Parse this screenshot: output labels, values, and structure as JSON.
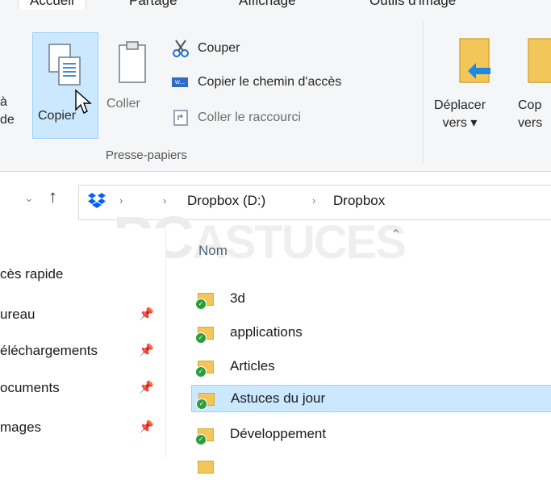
{
  "ribbon_tabs": [
    "Accueil",
    "Partage",
    "Affichage",
    "Outils d'image"
  ],
  "clipboard": {
    "pin_partial_line1": "à",
    "pin_partial_line2": "de",
    "copy_label": "Copier",
    "paste_label": "Coller",
    "cut_label": "Couper",
    "copy_path_label": "Copier le chemin d'accès",
    "paste_shortcut_label": "Coller le raccourci",
    "group_label": "Presse-papiers"
  },
  "organize": {
    "move_to_label1": "Déplacer",
    "move_to_label2": "vers ▾",
    "copy_to_label1": "Cop",
    "copy_to_label2": "vers"
  },
  "address": {
    "crumbs": [
      "Dropbox (D:)",
      "Dropbox"
    ]
  },
  "nav": {
    "items": [
      {
        "label": "cès rapide"
      },
      {
        "label": "ureau"
      },
      {
        "label": "éléchargements"
      },
      {
        "label": "ocuments"
      },
      {
        "label": "mages"
      }
    ]
  },
  "filelist": {
    "column_name": "Nom",
    "files": [
      "3d",
      "applications",
      "Articles",
      "Astuces du jour",
      "Développement"
    ],
    "selected_index": 3
  },
  "watermark": {
    "part1": "PC",
    "part2": "ASTUCES"
  },
  "colors": {
    "selection_bg": "#cce8ff",
    "selection_border": "#99d1ff",
    "folder": "#f3c65a",
    "sync_check": "#2b9e3b",
    "dropbox_blue": "#0061fe",
    "arrow_blue": "#1e88e5"
  }
}
